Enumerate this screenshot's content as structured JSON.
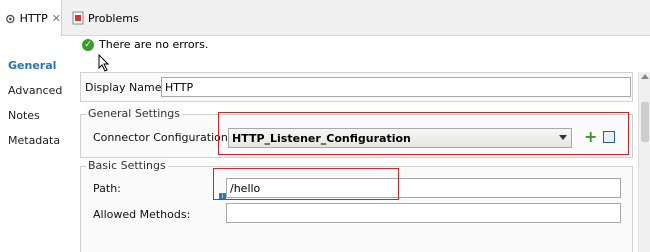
{
  "tabs": [
    {
      "label": "HTTP",
      "closable": true
    },
    {
      "label": "Problems"
    }
  ],
  "sidenav": {
    "items": [
      {
        "label": "General",
        "active": true
      },
      {
        "label": "Advanced"
      },
      {
        "label": "Notes"
      },
      {
        "label": "Metadata"
      }
    ]
  },
  "status": {
    "message": "There are no errors."
  },
  "display": {
    "label": "Display Name:",
    "value": "HTTP"
  },
  "general_settings": {
    "title": "General Settings",
    "connector_label": "Connector Configuration:",
    "connector_value": "HTTP_Listener_Configuration"
  },
  "basic_settings": {
    "title": "Basic Settings",
    "path_label": "Path:",
    "path_value": "/hello",
    "methods_label": "Allowed Methods:",
    "methods_value": ""
  },
  "colors": {
    "accent": "#2a74b8",
    "highlight": "#e02020",
    "ok": "#3a9a2c"
  }
}
